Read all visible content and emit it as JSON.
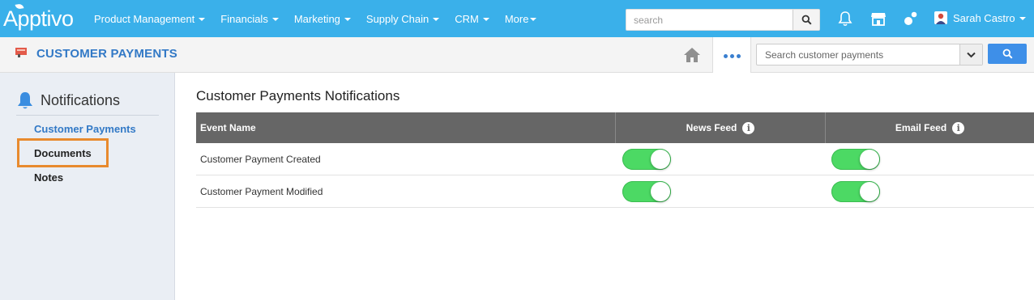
{
  "brand": {
    "logo_text": "Apptivo"
  },
  "nav": {
    "items": [
      {
        "label": "Product Management"
      },
      {
        "label": "Financials"
      },
      {
        "label": "Marketing"
      },
      {
        "label": "Supply Chain"
      },
      {
        "label": "CRM"
      },
      {
        "label": "More"
      }
    ],
    "search_placeholder": "search",
    "user_name": "Sarah Castro"
  },
  "app": {
    "title": "CUSTOMER PAYMENTS",
    "search_placeholder": "Search customer payments"
  },
  "sidebar": {
    "heading": "Notifications",
    "items": [
      {
        "label": "Customer Payments",
        "active": true
      },
      {
        "label": "Documents",
        "active": false,
        "highlighted": true
      },
      {
        "label": "Notes",
        "active": false
      }
    ]
  },
  "main": {
    "title": "Customer Payments Notifications",
    "columns": [
      "Event Name",
      "News Feed",
      "Email Feed"
    ],
    "rows": [
      {
        "event": "Customer Payment Created",
        "news_feed": true,
        "email_feed": true
      },
      {
        "event": "Customer Payment Modified",
        "news_feed": true,
        "email_feed": true
      }
    ]
  },
  "colors": {
    "topbar": "#3ab0ea",
    "accent": "#3279c6",
    "toggle_on": "#4cd964",
    "highlight": "#e88a2e",
    "table_header": "#666666"
  }
}
